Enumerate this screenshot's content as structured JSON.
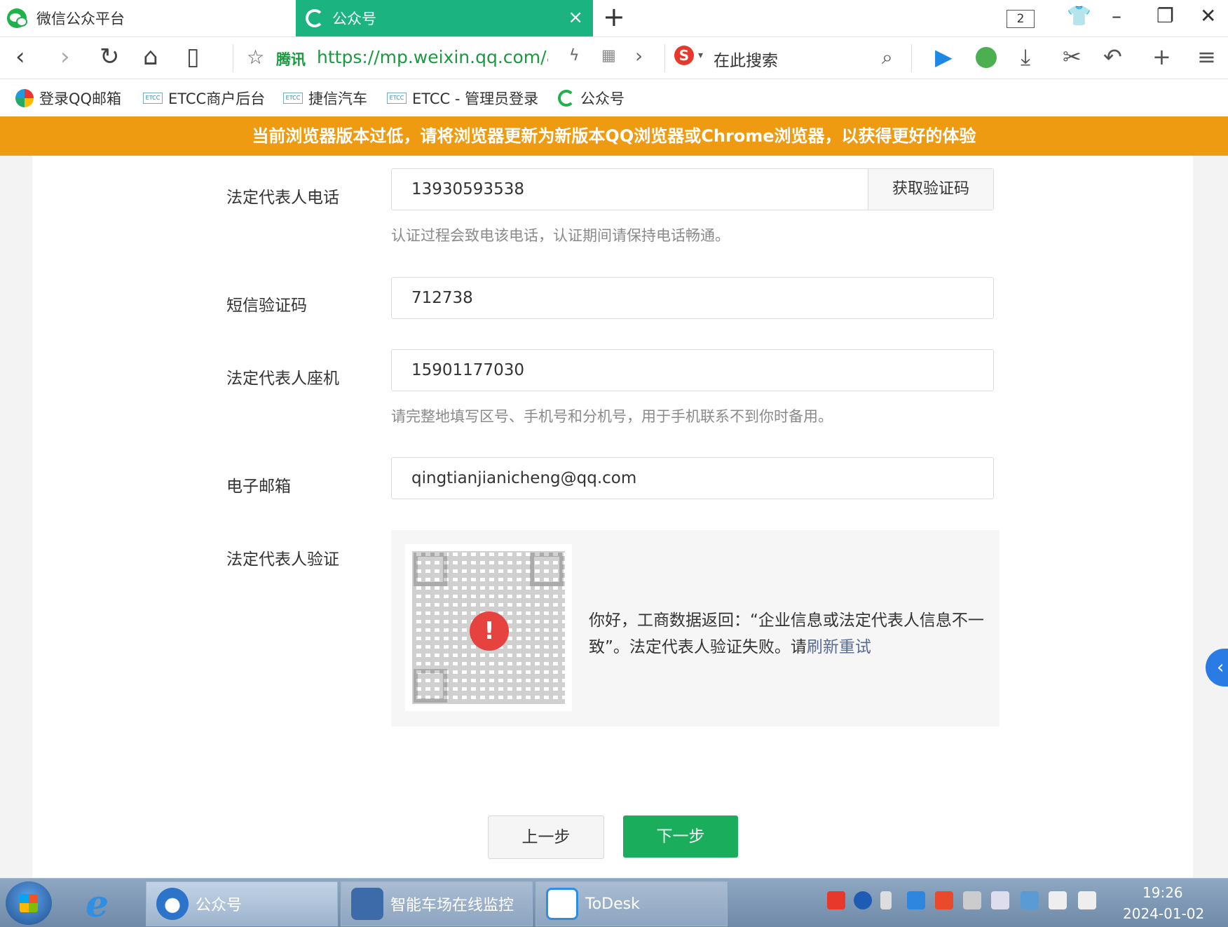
{
  "browser": {
    "tabs": [
      {
        "title": "微信公众平台",
        "active": false
      },
      {
        "title": "公众号",
        "active": true
      }
    ],
    "new_tab": "+",
    "close_tab": "×",
    "tab_count": "2",
    "window_controls": {
      "minimize": "–",
      "restore": "❐",
      "close": "✕"
    },
    "nav": {
      "back": "‹",
      "forward": "›",
      "reload": "↻",
      "home": "⌂",
      "reader": "▯"
    },
    "address": {
      "star": "☆",
      "brand": "腾讯",
      "url": "https://mp.weixin.qq.com/acct,",
      "flash": "ϟ",
      "qr": "▦",
      "go": "›"
    },
    "search": {
      "engine_logo": "S",
      "caret": "▾",
      "placeholder": "在此搜索",
      "icon": "⌕"
    },
    "toolbar": {
      "download": "⤓",
      "cut": "✂",
      "undo": "↶",
      "add": "+",
      "menu": "≡"
    },
    "bookmarks": [
      {
        "label": "登录QQ邮箱",
        "icon": "qq-mail-icon"
      },
      {
        "label": "ETCC商户后台",
        "icon": "etcc-icon"
      },
      {
        "label": "捷信汽车",
        "icon": "etcc-icon"
      },
      {
        "label": "ETCC - 管理员登录",
        "icon": "etcc-icon"
      },
      {
        "label": "公众号",
        "icon": "gongzhonghao-icon"
      }
    ],
    "banner": "当前浏览器版本过低，请将浏览器更新为新版本QQ浏览器或Chrome浏览器，以获得更好的体验"
  },
  "form": {
    "phone": {
      "label": "法定代表人电话",
      "value": "13930593538",
      "button": "获取验证码",
      "hint": "认证过程会致电该电话，认证期间请保持电话畅通。"
    },
    "sms": {
      "label": "短信验证码",
      "value": "712738"
    },
    "landline": {
      "label": "法定代表人座机",
      "value": "15901177030",
      "hint": "请完整地填写区号、手机号和分机号，用于手机联系不到你时备用。"
    },
    "email": {
      "label": "电子邮箱",
      "value": "qingtianjianicheng@qq.com"
    },
    "verify": {
      "label": "法定代表人验证",
      "error_mark": "!",
      "message": "你好，工商数据返回：“企业信息或法定代表人信息不一致”。法定代表人验证失败。请",
      "retry_link": "刷新重试"
    },
    "prev_button": "上一步",
    "next_button": "下一步"
  },
  "side_tab": "‹",
  "taskbar": {
    "tasks": [
      {
        "label": "公众号"
      },
      {
        "label": "智能车场在线监控"
      },
      {
        "label": "ToDesk"
      }
    ],
    "clock_time": "19:26",
    "clock_date": "2024-01-02"
  },
  "colors": {
    "accent_green": "#1aad5b",
    "tab_green": "#1bb481",
    "banner_orange": "#ee9b12",
    "error_red": "#e64340",
    "link_blue": "#576b95"
  }
}
